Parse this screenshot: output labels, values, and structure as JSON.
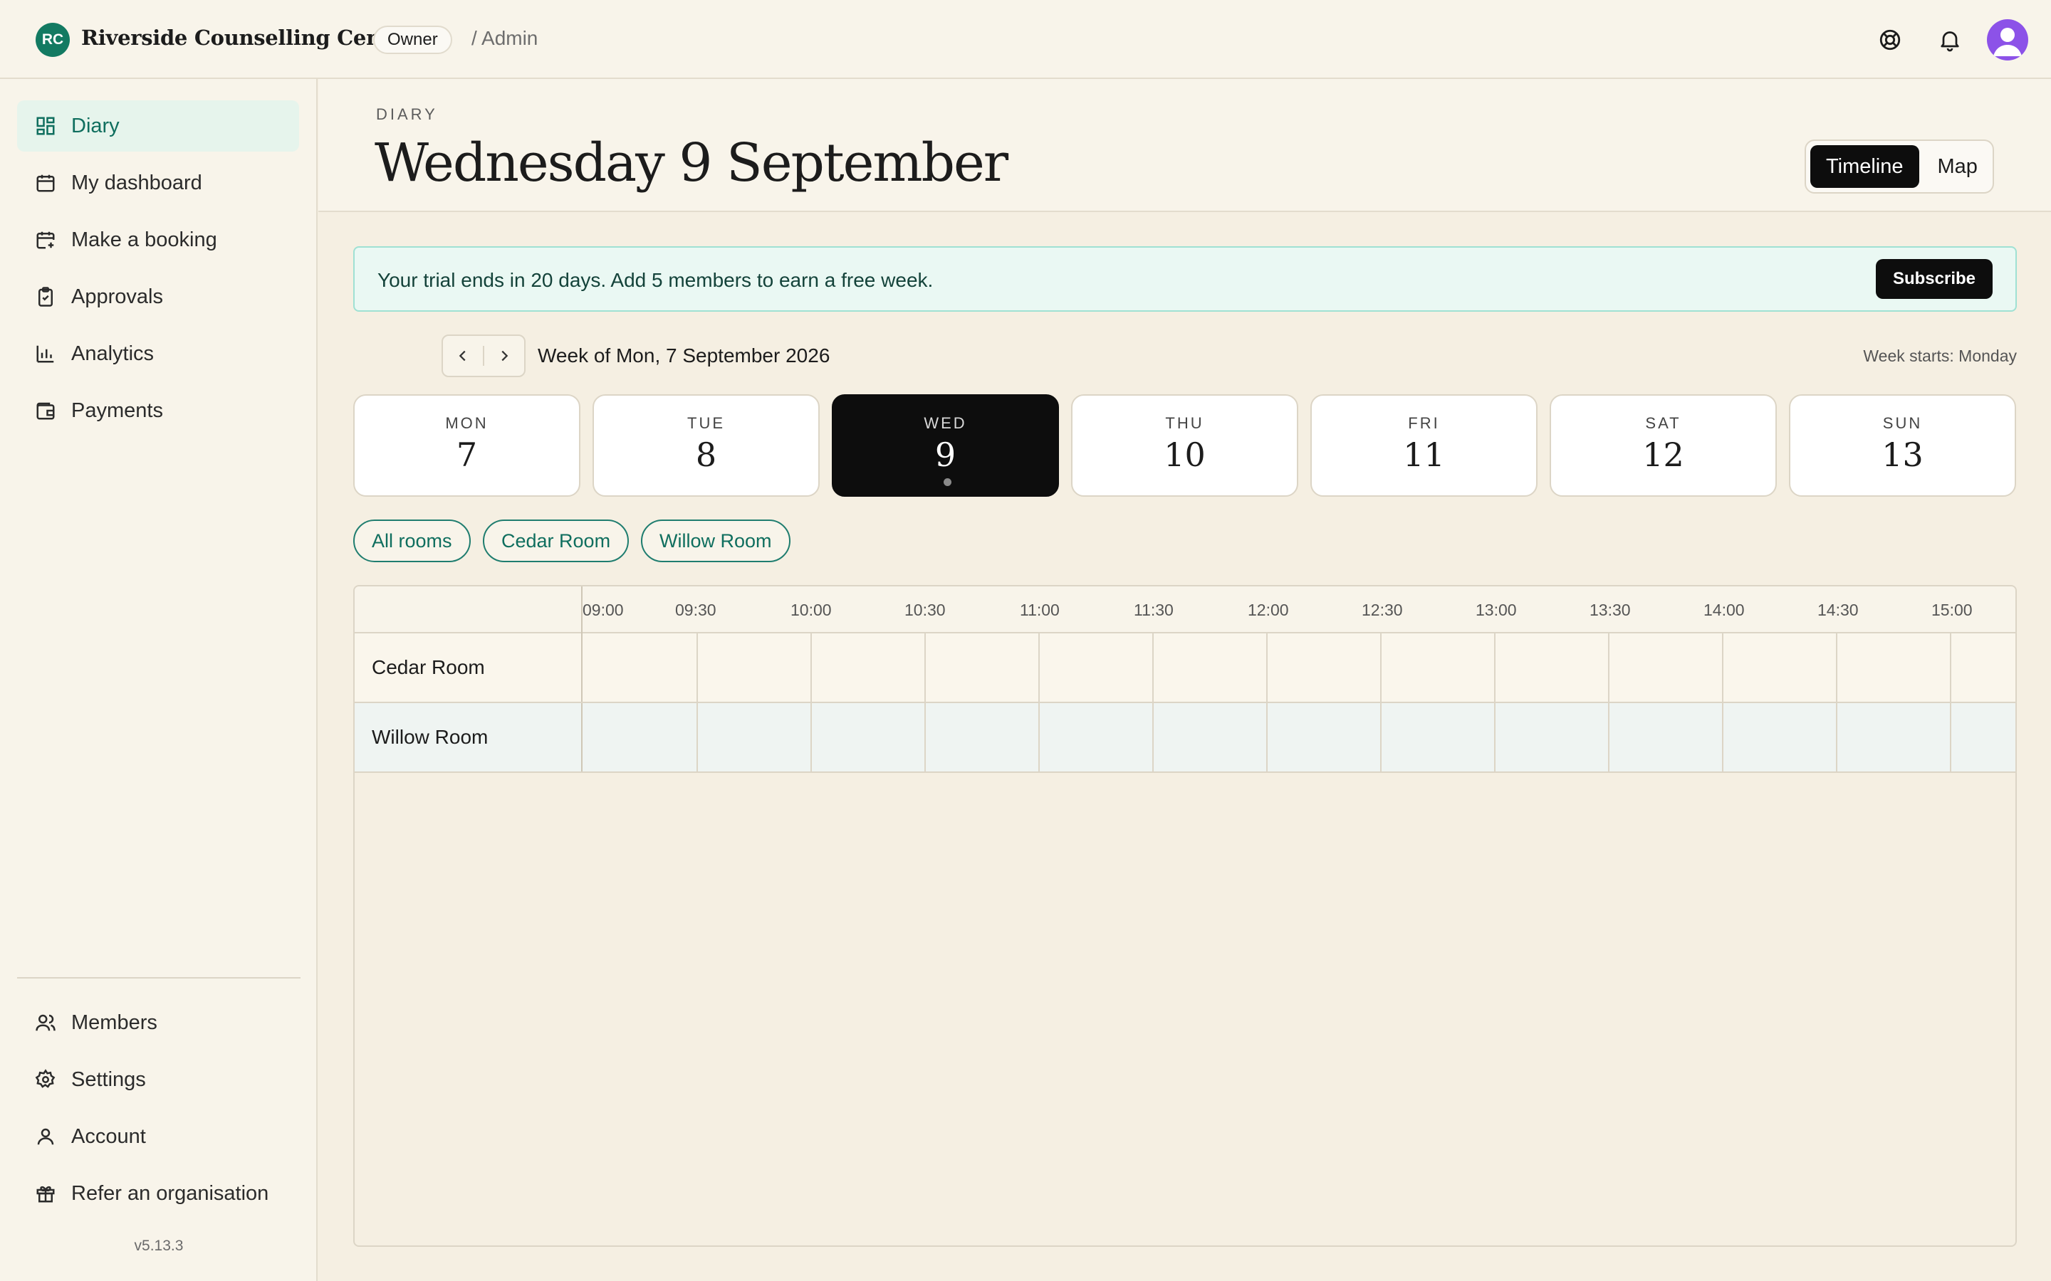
{
  "header": {
    "logo_initials": "RC",
    "org_name": "Riverside Counselling Centre",
    "role": "Owner",
    "breadcrumb": "/ Admin",
    "icons": [
      "help-icon",
      "bell-icon",
      "avatar"
    ]
  },
  "sidebar": {
    "items": [
      {
        "label": "Diary",
        "icon": "grid-icon",
        "active": true
      },
      {
        "label": "My dashboard",
        "icon": "calendar-icon"
      },
      {
        "label": "Make a booking",
        "icon": "calendar-plus-icon"
      },
      {
        "label": "Approvals",
        "icon": "clipboard-check-icon"
      },
      {
        "label": "Analytics",
        "icon": "bar-chart-icon"
      },
      {
        "label": "Payments",
        "icon": "wallet-icon"
      }
    ],
    "bottom_items": [
      {
        "label": "Members",
        "icon": "users-icon"
      },
      {
        "label": "Settings",
        "icon": "gear-icon"
      },
      {
        "label": "Account",
        "icon": "user-icon"
      },
      {
        "label": "Refer an organisation",
        "icon": "gift-icon"
      }
    ],
    "version": "v5.13.3"
  },
  "main": {
    "eyebrow": "DIARY",
    "title": "Wednesday 9 September",
    "view_toggle": {
      "options": [
        "Timeline",
        "Map"
      ],
      "selected": "Timeline"
    }
  },
  "banner": {
    "text": "Your trial ends in 20 days. Add 5 members to earn a free week.",
    "button": "Subscribe"
  },
  "week": {
    "label": "Week of Mon, 7 September 2026",
    "week_starts": "Week starts: Monday",
    "days": [
      {
        "name": "MON",
        "num": "7"
      },
      {
        "name": "TUE",
        "num": "8"
      },
      {
        "name": "WED",
        "num": "9",
        "selected": true,
        "has_event": true
      },
      {
        "name": "THU",
        "num": "10"
      },
      {
        "name": "FRI",
        "num": "11"
      },
      {
        "name": "SAT",
        "num": "12"
      },
      {
        "name": "SUN",
        "num": "13"
      }
    ]
  },
  "room_filters": [
    "All rooms",
    "Cedar Room",
    "Willow Room"
  ],
  "timeline": {
    "times": [
      "09:00",
      "09:30",
      "10:00",
      "10:30",
      "11:00",
      "11:30",
      "12:00",
      "12:30",
      "13:00",
      "13:30",
      "14:00",
      "14:30",
      "15:00"
    ],
    "rooms": [
      {
        "name": "Cedar Room",
        "color": "#faf6ec"
      },
      {
        "name": "Willow Room",
        "color": "#eff4f2"
      }
    ]
  },
  "colors": {
    "accent": "#137a62",
    "background": "#f5efe2",
    "panel": "#f8f4ea",
    "banner_bg": "#eaf8f3",
    "selected_day": "#0d0d0d"
  }
}
